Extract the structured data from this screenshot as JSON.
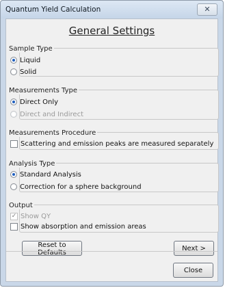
{
  "window": {
    "title": "Quantum Yield Calculation",
    "close_glyph": "✕"
  },
  "heading": "General Settings",
  "sample_type": {
    "label": "Sample Type",
    "options": [
      {
        "label": "Liquid",
        "selected": true,
        "enabled": true
      },
      {
        "label": "Solid",
        "selected": false,
        "enabled": true
      }
    ]
  },
  "measurements_type": {
    "label": "Measurements Type",
    "options": [
      {
        "label": "Direct Only",
        "selected": true,
        "enabled": false
      },
      {
        "label": "Direct and Indirect",
        "selected": false,
        "enabled": false
      }
    ]
  },
  "measurements_procedure": {
    "label": "Measurements Procedure",
    "checkbox_label": "Scattering and emission peaks are measured separately",
    "checked": false
  },
  "analysis_type": {
    "label": "Analysis Type",
    "options": [
      {
        "label": "Standard Analysis",
        "selected": true,
        "enabled": true
      },
      {
        "label": "Correction for a sphere background",
        "selected": false,
        "enabled": true
      }
    ]
  },
  "output": {
    "label": "Output",
    "show_qy": {
      "label": "Show QY",
      "checked": true,
      "enabled": false
    },
    "show_areas": {
      "label": "Show absorption and emission areas",
      "checked": false,
      "enabled": true
    }
  },
  "buttons": {
    "reset": "Reset to Defaults",
    "next": "Next >",
    "close": "Close"
  },
  "icons": {
    "check_glyph": "✓"
  },
  "colors": {
    "radio_selected": "#1f5fbf",
    "titlebar": "#c5d5e8",
    "panel": "#f0f0f0"
  }
}
